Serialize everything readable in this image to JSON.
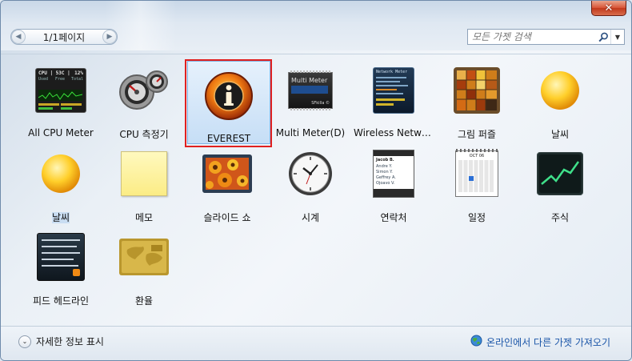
{
  "window": {
    "close_label": "✕"
  },
  "pager": {
    "text": "1/1페이지",
    "prev_glyph": "◀",
    "next_glyph": "▶"
  },
  "search": {
    "placeholder": "모든 가젯 검색",
    "dropdown_glyph": "▼"
  },
  "gadgets": [
    {
      "label": "All CPU Meter",
      "icon": "cpu-meter-icon"
    },
    {
      "label": "CPU 측정기",
      "icon": "cpu-gauge-icon"
    },
    {
      "label": "EVEREST",
      "icon": "everest-info-icon",
      "selected": true
    },
    {
      "label": "Multi Meter(D)",
      "icon": "multi-meter-icon"
    },
    {
      "label": "Wireless Netwo...",
      "icon": "network-meter-icon"
    },
    {
      "label": "그림 퍼즐",
      "icon": "picture-puzzle-icon"
    },
    {
      "label": "날씨",
      "icon": "weather-sun-icon"
    },
    {
      "label": "날씨",
      "icon": "weather-sun-icon"
    },
    {
      "label": "메모",
      "icon": "notes-icon"
    },
    {
      "label": "슬라이드 쇼",
      "icon": "slideshow-icon"
    },
    {
      "label": "시계",
      "icon": "clock-icon"
    },
    {
      "label": "연락처",
      "icon": "contacts-icon"
    },
    {
      "label": "일정",
      "icon": "calendar-icon"
    },
    {
      "label": "주식",
      "icon": "stocks-icon"
    },
    {
      "label": "피드 헤드라인",
      "icon": "feed-headlines-icon"
    },
    {
      "label": "환율",
      "icon": "currency-icon"
    }
  ],
  "cpu_meter": {
    "title": "CPU | 53C |",
    "percent": "12%",
    "col1": "Used",
    "col2": "Free",
    "col3": "Total"
  },
  "multi_meter": {
    "title": "Multi Meter",
    "footer": "SFkilla ©"
  },
  "network_meter": {
    "title": "Network Meter"
  },
  "contacts": {
    "items": [
      "Jacob B.",
      "Andre Y.",
      "Simon Y.",
      "Geffrey A.",
      "Ojoavo V."
    ]
  },
  "calendar": {
    "month": "OCT 06"
  },
  "footer": {
    "details_label": "자세한 정보 표시",
    "details_glyph": "⌄",
    "online_label": "온라인에서 다른 가젯 가져오기"
  }
}
